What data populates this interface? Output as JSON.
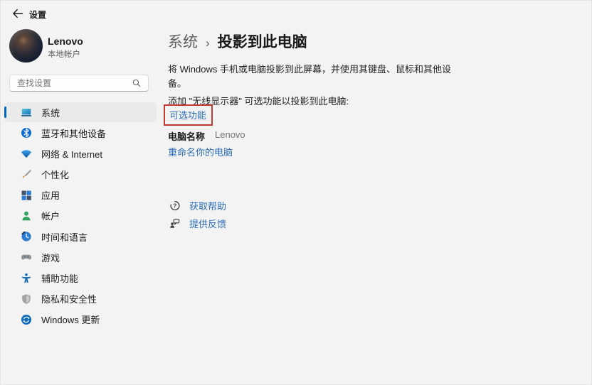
{
  "colors": {
    "accent": "#0067C0",
    "link": "#2C6CB5",
    "highlight_box": "#C33C33"
  },
  "window": {
    "title": "设置",
    "back_icon": "back-arrow"
  },
  "user": {
    "name": "Lenovo",
    "account_type": "本地帐户"
  },
  "search": {
    "placeholder": "查找设置",
    "icon": "search-icon"
  },
  "sidebar": {
    "items": [
      {
        "key": "system",
        "label": "系统",
        "icon": "system-icon",
        "selected": true
      },
      {
        "key": "bluetooth",
        "label": "蓝牙和其他设备",
        "icon": "bluetooth-icon",
        "selected": false
      },
      {
        "key": "network",
        "label": "网络 & Internet",
        "icon": "network-icon",
        "selected": false
      },
      {
        "key": "personalization",
        "label": "个性化",
        "icon": "personalization-icon",
        "selected": false
      },
      {
        "key": "apps",
        "label": "应用",
        "icon": "apps-icon",
        "selected": false
      },
      {
        "key": "accounts",
        "label": "帐户",
        "icon": "accounts-icon",
        "selected": false
      },
      {
        "key": "time-language",
        "label": "时间和语言",
        "icon": "time-language-icon",
        "selected": false
      },
      {
        "key": "gaming",
        "label": "游戏",
        "icon": "gaming-icon",
        "selected": false
      },
      {
        "key": "accessibility",
        "label": "辅助功能",
        "icon": "accessibility-icon",
        "selected": false
      },
      {
        "key": "privacy-security",
        "label": "隐私和安全性",
        "icon": "privacy-icon",
        "selected": false
      },
      {
        "key": "windows-update",
        "label": "Windows 更新",
        "icon": "update-icon",
        "selected": false
      }
    ]
  },
  "main": {
    "breadcrumb": {
      "parent": "系统",
      "separator": "›",
      "current": "投影到此电脑"
    },
    "description": "将 Windows 手机或电脑投影到此屏幕，并使用其键盘、鼠标和其他设备。",
    "optional_feature_hint": "添加 \"无线显示器\" 可选功能以投影到此电脑:",
    "optional_feature_link": "可选功能",
    "pc_name_label": "电脑名称",
    "pc_name_value": "Lenovo",
    "rename_link": "重命名你的电脑",
    "help_links": [
      {
        "key": "get-help",
        "label": "获取帮助",
        "icon": "help-icon"
      },
      {
        "key": "give-feedback",
        "label": "提供反馈",
        "icon": "feedback-icon"
      }
    ]
  }
}
